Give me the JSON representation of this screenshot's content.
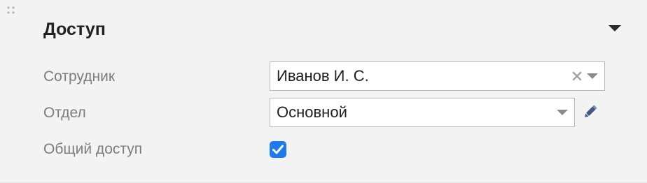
{
  "section": {
    "title": "Доступ",
    "drag_icon": "drag-dots-icon",
    "collapse_icon": "triangle-down-icon"
  },
  "fields": {
    "employee": {
      "label": "Сотрудник",
      "value": "Иванов И. С.",
      "clear_icon": "clear-x-icon",
      "dropdown_icon": "chevron-down-icon"
    },
    "department": {
      "label": "Отдел",
      "value": "Основной",
      "dropdown_icon": "chevron-down-icon",
      "edit_icon": "pencil-icon"
    },
    "shared_access": {
      "label": "Общий доступ",
      "checked": true
    }
  },
  "colors": {
    "panel_background": "#f3f3f3",
    "label_text": "#7d7d7d",
    "checkbox_accent": "#1f7af0",
    "edit_icon": "#3d5a80"
  }
}
